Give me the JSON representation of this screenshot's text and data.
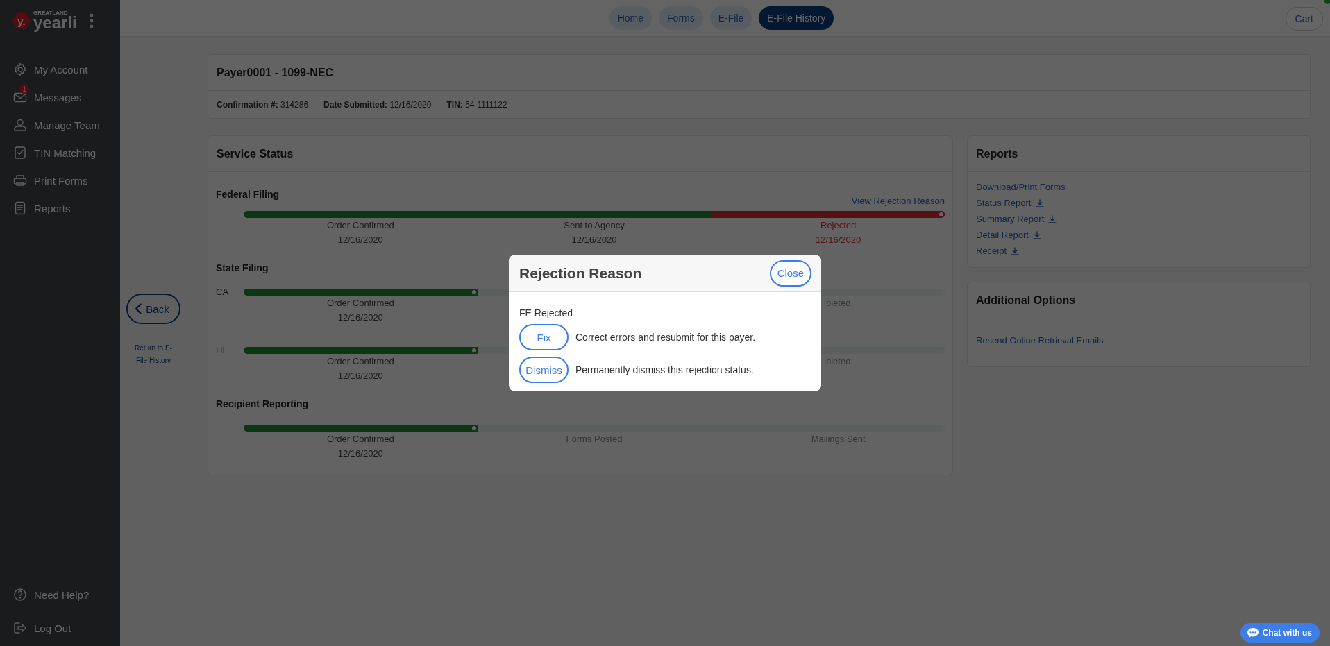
{
  "sidebar": {
    "logo": {
      "mark": "y.",
      "tagline": "GREATLAND",
      "brand": "yearli"
    },
    "items": [
      {
        "label": "My Account",
        "kind": "account"
      },
      {
        "label": "Messages",
        "kind": "messages",
        "badge": "1"
      },
      {
        "label": "Manage Team",
        "kind": "team"
      },
      {
        "label": "TIN Matching",
        "kind": "tin"
      },
      {
        "label": "Print Forms",
        "kind": "print"
      },
      {
        "label": "Reports",
        "kind": "reports"
      }
    ],
    "footer_items": [
      {
        "label": "Need Help?",
        "kind": "help"
      },
      {
        "label": "Log Out",
        "kind": "logout"
      }
    ]
  },
  "top_nav": {
    "tabs": [
      {
        "label": "Home",
        "selected": false
      },
      {
        "label": "Forms",
        "selected": false
      },
      {
        "label": "E-File",
        "selected": false
      },
      {
        "label": "E-File History",
        "selected": true
      }
    ],
    "cart": {
      "label": "Cart"
    }
  },
  "back": {
    "label": "Back",
    "caption": "Return to E-File History"
  },
  "header_card": {
    "title": "Payer0001 - 1099-NEC",
    "details": [
      {
        "label": "Confirmation #:",
        "value": "314286"
      },
      {
        "label": "Date Submitted:",
        "value": "12/16/2020"
      },
      {
        "label": "TIN:",
        "value": "54-1111122"
      }
    ]
  },
  "service_status": {
    "title": "Service Status",
    "sections": [
      {
        "heading": "Federal Filing",
        "link": "View Rejection Reason",
        "rows": [
          {
            "steps": [
              {
                "label": "Order Confirmed",
                "date": "12/16/2020",
                "kind": "done"
              },
              {
                "label": "Sent to Agency",
                "date": "12/16/2020",
                "kind": "done"
              },
              {
                "label": "Rejected",
                "date": "12/16/2020",
                "kind": "rejected"
              }
            ]
          }
        ]
      },
      {
        "heading": "State Filing",
        "rows": [
          {
            "label": "CA",
            "steps": [
              {
                "label": "Order Confirmed",
                "date": "12/16/2020",
                "kind": "done"
              },
              {
                "kind": "pending"
              },
              {
                "label": "pleted",
                "kind": "pending"
              }
            ]
          },
          {
            "label": "HI",
            "steps": [
              {
                "label": "Order Confirmed",
                "date": "12/16/2020",
                "kind": "done"
              },
              {
                "kind": "pending"
              },
              {
                "label": "pleted",
                "kind": "pending"
              }
            ]
          }
        ]
      },
      {
        "heading": "Recipient Reporting",
        "rows": [
          {
            "steps": [
              {
                "label": "Order Confirmed",
                "date": "12/16/2020",
                "kind": "done"
              },
              {
                "label": "Forms Posted",
                "kind": "pending"
              },
              {
                "label": "Mailings Sent",
                "kind": "pending"
              }
            ]
          }
        ]
      }
    ]
  },
  "reports": {
    "title": "Reports",
    "links": [
      {
        "label": "Download/Print Forms",
        "download": false
      },
      {
        "label": "Status Report",
        "download": true
      },
      {
        "label": "Summary Report",
        "download": true
      },
      {
        "label": "Detail Report",
        "download": true
      },
      {
        "label": "Receipt",
        "download": true
      }
    ]
  },
  "additional_options": {
    "title": "Additional Options",
    "links": [
      {
        "label": "Resend Online Retrieval Emails"
      }
    ]
  },
  "modal": {
    "title": "Rejection Reason",
    "close": "Close",
    "status": "FE Rejected",
    "actions": [
      {
        "button": "Fix",
        "description": "Correct errors and resubmit for this payer."
      },
      {
        "button": "Dismiss",
        "description": "Permanently dismiss this rejection status."
      }
    ]
  },
  "chat": {
    "label": "Chat with us"
  }
}
